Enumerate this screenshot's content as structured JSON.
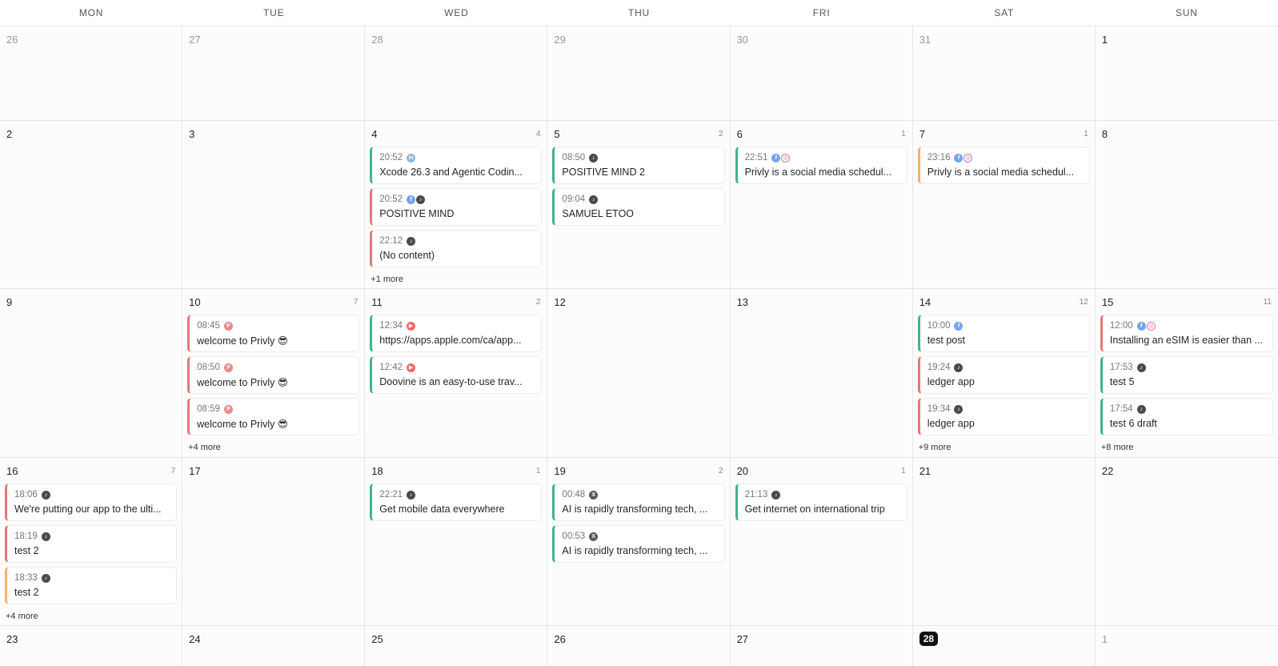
{
  "weekdays": [
    "MON",
    "TUE",
    "WED",
    "THU",
    "FRI",
    "SAT",
    "SUN"
  ],
  "weeks": [
    {
      "days": [
        {
          "num": "26",
          "muted": true,
          "events": []
        },
        {
          "num": "27",
          "muted": true,
          "events": []
        },
        {
          "num": "28",
          "muted": true,
          "events": []
        },
        {
          "num": "29",
          "muted": true,
          "events": []
        },
        {
          "num": "30",
          "muted": true,
          "events": []
        },
        {
          "num": "31",
          "muted": true,
          "events": []
        },
        {
          "num": "1",
          "events": []
        }
      ]
    },
    {
      "days": [
        {
          "num": "2",
          "events": []
        },
        {
          "num": "3",
          "events": []
        },
        {
          "num": "4",
          "count": "4",
          "events": [
            {
              "time": "20:52",
              "icons": [
                "linkedin"
              ],
              "title": "Xcode 26.3 and Agentic Codin...",
              "color": "green"
            },
            {
              "time": "20:52",
              "icons": [
                "facebook",
                "tiktok"
              ],
              "title": "POSITIVE MIND",
              "color": "red"
            },
            {
              "time": "22:12",
              "icons": [
                "tiktok"
              ],
              "title": "(No content)",
              "color": "red"
            }
          ],
          "more": "+1 more"
        },
        {
          "num": "5",
          "count": "2",
          "events": [
            {
              "time": "08:50",
              "icons": [
                "tiktok"
              ],
              "title": "POSITIVE MIND 2",
              "color": "green"
            },
            {
              "time": "09:04",
              "icons": [
                "tiktok"
              ],
              "title": "SAMUEL ETOO",
              "color": "green"
            }
          ]
        },
        {
          "num": "6",
          "count": "1",
          "events": [
            {
              "time": "22:51",
              "icons": [
                "facebook",
                "instagram"
              ],
              "title": "Privly is a social media schedul...",
              "color": "green"
            }
          ]
        },
        {
          "num": "7",
          "count": "1",
          "events": [
            {
              "time": "23:16",
              "icons": [
                "facebook",
                "instagram"
              ],
              "title": "Privly is a social media schedul...",
              "color": "orange"
            }
          ]
        },
        {
          "num": "8",
          "events": []
        }
      ]
    },
    {
      "days": [
        {
          "num": "9",
          "events": []
        },
        {
          "num": "10",
          "count": "7",
          "events": [
            {
              "time": "08:45",
              "icons": [
                "pinterest"
              ],
              "title": "welcome to Privly 😎",
              "color": "red"
            },
            {
              "time": "08:50",
              "icons": [
                "pinterest"
              ],
              "title": "welcome to Privly 😎",
              "color": "red"
            },
            {
              "time": "08:59",
              "icons": [
                "pinterest"
              ],
              "title": "welcome to Privly 😎",
              "color": "red"
            }
          ],
          "more": "+4 more"
        },
        {
          "num": "11",
          "count": "2",
          "events": [
            {
              "time": "12:34",
              "icons": [
                "youtube"
              ],
              "title": "https://apps.apple.com/ca/app...",
              "color": "green"
            },
            {
              "time": "12:42",
              "icons": [
                "youtube"
              ],
              "title": "Doovine is an easy-to-use trav...",
              "color": "green"
            }
          ]
        },
        {
          "num": "12",
          "events": []
        },
        {
          "num": "13",
          "events": []
        },
        {
          "num": "14",
          "count": "12",
          "events": [
            {
              "time": "10:00",
              "icons": [
                "facebook"
              ],
              "title": "test post",
              "color": "green"
            },
            {
              "time": "19:24",
              "icons": [
                "tiktok"
              ],
              "title": "ledger app",
              "color": "red"
            },
            {
              "time": "19:34",
              "icons": [
                "tiktok"
              ],
              "title": "ledger app",
              "color": "red"
            }
          ],
          "more": "+9 more"
        },
        {
          "num": "15",
          "count": "11",
          "events": [
            {
              "time": "12:00",
              "icons": [
                "facebook",
                "instagram"
              ],
              "title": "Installing an eSIM is easier than ...",
              "color": "red"
            },
            {
              "time": "17:53",
              "icons": [
                "tiktok"
              ],
              "title": "test 5",
              "color": "green"
            },
            {
              "time": "17:54",
              "icons": [
                "tiktok"
              ],
              "title": "test 6 draft",
              "color": "green"
            }
          ],
          "more": "+8 more"
        }
      ]
    },
    {
      "days": [
        {
          "num": "16",
          "count": "7",
          "events": [
            {
              "time": "18:06",
              "icons": [
                "tiktok"
              ],
              "title": "We're putting our app to the ulti...",
              "color": "red"
            },
            {
              "time": "18:19",
              "icons": [
                "tiktok"
              ],
              "title": "test 2",
              "color": "red"
            },
            {
              "time": "18:33",
              "icons": [
                "tiktok"
              ],
              "title": "test 2",
              "color": "orange"
            }
          ],
          "more": "+4 more"
        },
        {
          "num": "17",
          "events": []
        },
        {
          "num": "18",
          "count": "1",
          "events": [
            {
              "time": "22:21",
              "icons": [
                "tiktok"
              ],
              "title": "Get mobile data everywhere",
              "color": "green"
            }
          ]
        },
        {
          "num": "19",
          "count": "2",
          "events": [
            {
              "time": "00:48",
              "icons": [
                "x"
              ],
              "title": "AI is rapidly transforming tech, ...",
              "color": "green"
            },
            {
              "time": "00:53",
              "icons": [
                "x"
              ],
              "title": "AI is rapidly transforming tech, ...",
              "color": "green"
            }
          ]
        },
        {
          "num": "20",
          "count": "1",
          "events": [
            {
              "time": "21:13",
              "icons": [
                "tiktok"
              ],
              "title": "Get internet on international trip",
              "color": "green"
            }
          ]
        },
        {
          "num": "21",
          "events": []
        },
        {
          "num": "22",
          "events": []
        }
      ]
    },
    {
      "days": [
        {
          "num": "23",
          "events": []
        },
        {
          "num": "24",
          "events": []
        },
        {
          "num": "25",
          "events": []
        },
        {
          "num": "26",
          "events": []
        },
        {
          "num": "27",
          "events": []
        },
        {
          "num": "28",
          "today": true,
          "events": []
        },
        {
          "num": "1",
          "muted": true,
          "events": []
        }
      ]
    }
  ],
  "icon_glyphs": {
    "linkedin": "in",
    "facebook": "f",
    "tiktok": "♪",
    "instagram": "◎",
    "pinterest": "P",
    "youtube": "▶",
    "x": "X"
  },
  "colors": {
    "green": "#3fb38f",
    "red": "#e07a7a",
    "orange": "#f0b46a",
    "today_bg": "#111111"
  }
}
